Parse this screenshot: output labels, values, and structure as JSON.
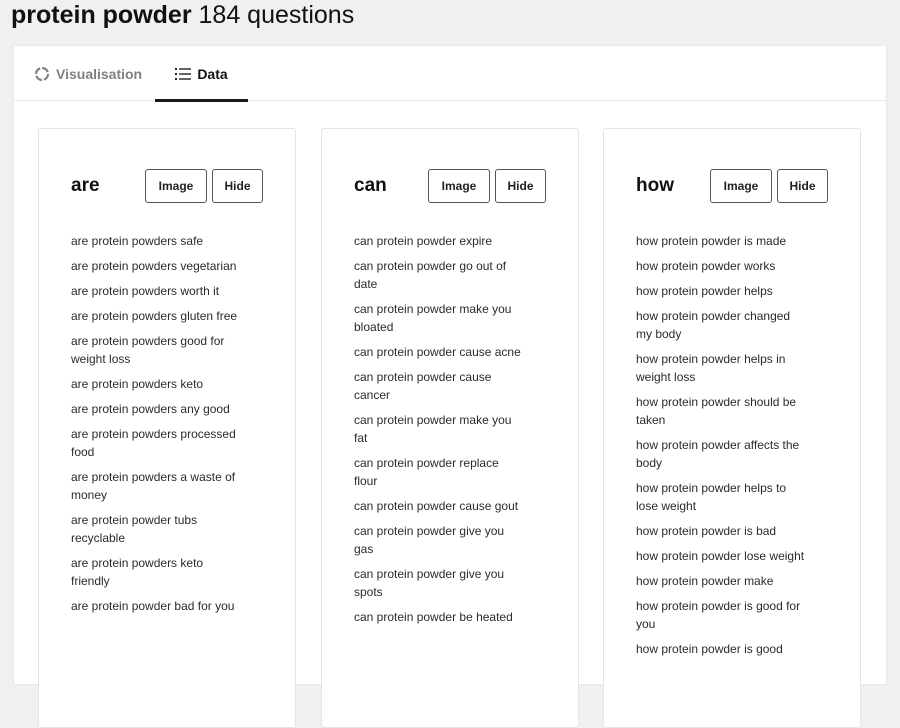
{
  "header": {
    "keyword": "protein powder",
    "count_label": "184 questions"
  },
  "tabs": [
    {
      "label": "Visualisation",
      "icon": "circle-loader-icon",
      "active": false
    },
    {
      "label": "Data",
      "icon": "list-icon",
      "active": true
    }
  ],
  "cards": [
    {
      "title": "are",
      "image_label": "Image",
      "hide_label": "Hide",
      "questions": [
        "are protein powders safe",
        "are protein powders vegetarian",
        "are protein powders worth it",
        "are protein powders gluten free",
        "are protein powders good for weight loss",
        "are protein powders keto",
        "are protein powders any good",
        "are protein powders processed food",
        "are protein powders a waste of money",
        "are protein powder tubs recyclable",
        "are protein powders keto friendly",
        "are protein powder bad for you"
      ]
    },
    {
      "title": "can",
      "image_label": "Image",
      "hide_label": "Hide",
      "questions": [
        "can protein powder expire",
        "can protein powder go out of date",
        "can protein powder make you bloated",
        "can protein powder cause acne",
        "can protein powder cause cancer",
        "can protein powder make you fat",
        "can protein powder replace flour",
        "can protein powder cause gout",
        "can protein powder give you gas",
        "can protein powder give you spots",
        "can protein powder be heated"
      ]
    },
    {
      "title": "how",
      "image_label": "Image",
      "hide_label": "Hide",
      "questions": [
        "how protein powder is made",
        "how protein powder works",
        "how protein powder helps",
        "how protein powder changed my body",
        "how protein powder helps in weight loss",
        "how protein powder should be taken",
        "how protein powder affects the body",
        "how protein powder helps to lose weight",
        "how protein powder is bad",
        "how protein powder lose weight",
        "how protein powder make",
        "how protein powder is good for you",
        "how protein powder is good"
      ]
    }
  ]
}
